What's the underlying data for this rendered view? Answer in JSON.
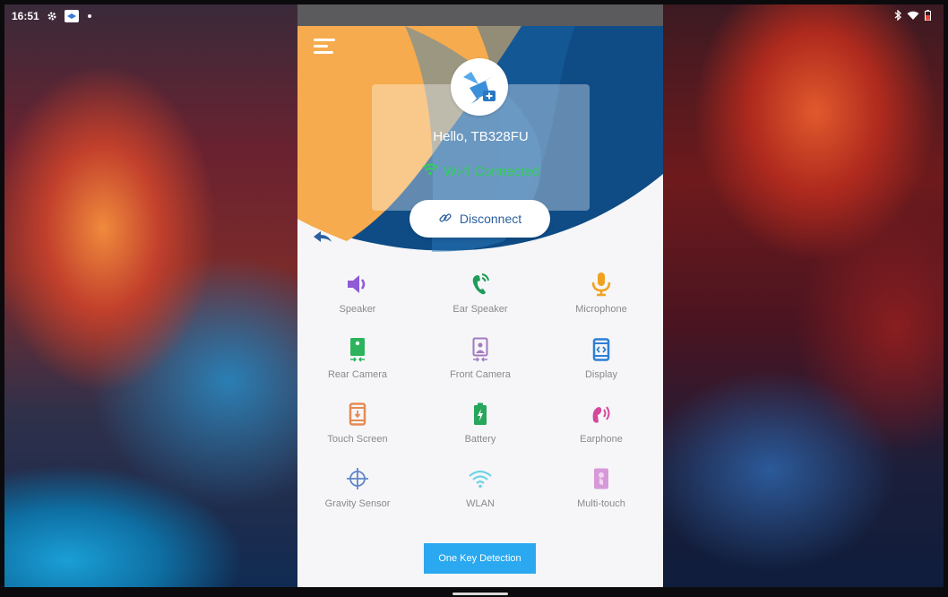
{
  "status_bar": {
    "time": "16:51",
    "left_icons": [
      "gear-icon",
      "app-notification-icon",
      "dot-icon"
    ],
    "right_icons": [
      "bluetooth-icon",
      "wifi-icon",
      "battery-icon"
    ]
  },
  "app": {
    "greeting": "Hello, TB328FU",
    "wifi_status": "Wi-fi Connected",
    "disconnect_label": "Disconnect",
    "tests": [
      {
        "label": "Speaker",
        "icon": "speaker-icon",
        "color": "#8e5ad6"
      },
      {
        "label": "Ear Speaker",
        "icon": "ear-speaker-icon",
        "color": "#1f9b5a"
      },
      {
        "label": "Microphone",
        "icon": "microphone-icon",
        "color": "#f0a21f"
      },
      {
        "label": "Rear Camera",
        "icon": "rear-camera-icon",
        "color": "#2db35c"
      },
      {
        "label": "Front Camera",
        "icon": "front-camera-icon",
        "color": "#a37ac2"
      },
      {
        "label": "Display",
        "icon": "display-icon",
        "color": "#2e7fd6"
      },
      {
        "label": "Touch Screen",
        "icon": "touch-screen-icon",
        "color": "#e58b55"
      },
      {
        "label": "Battery",
        "icon": "battery-icon",
        "color": "#27a65c"
      },
      {
        "label": "Earphone",
        "icon": "earphone-icon",
        "color": "#d24a9c"
      },
      {
        "label": "Gravity Sensor",
        "icon": "gravity-sensor-icon",
        "color": "#5f86c9"
      },
      {
        "label": "WLAN",
        "icon": "wlan-icon",
        "color": "#6fd3e6"
      },
      {
        "label": "Multi-touch",
        "icon": "multi-touch-icon",
        "color": "#d79ad9"
      }
    ],
    "detect_label": "One Key Detection"
  },
  "colors": {
    "accent_blue": "#2aa8f0",
    "wifi_green": "#2fd256",
    "hero_navy": "#0f4c86",
    "hero_orange": "#f6ab4e"
  }
}
